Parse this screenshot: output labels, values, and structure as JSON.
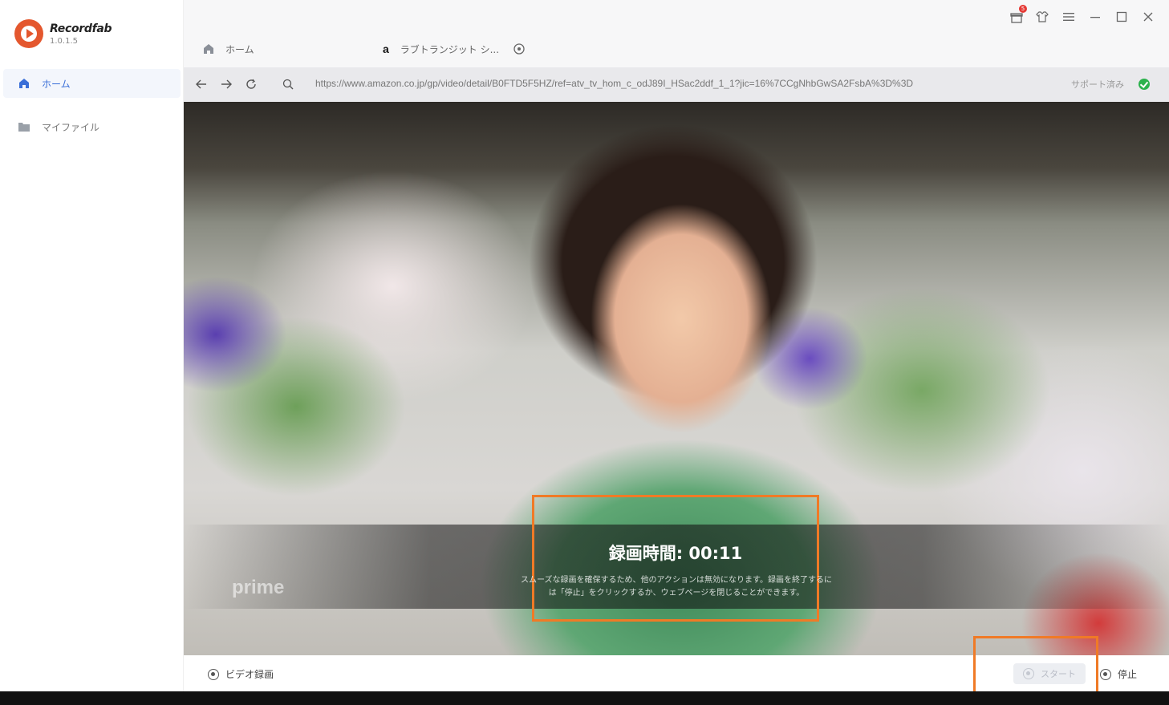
{
  "app": {
    "name": "Recordfab",
    "version": "1.0.1.5"
  },
  "sidebar": {
    "items": [
      {
        "label": "ホーム",
        "icon": "home-icon",
        "active": true
      },
      {
        "label": "マイファイル",
        "icon": "folder-icon",
        "active": false
      }
    ]
  },
  "tabs": [
    {
      "label": "ホーム",
      "icon": "home-icon"
    },
    {
      "label": "ラブトランジット シ...",
      "icon": "amazon-icon"
    }
  ],
  "window_controls": {
    "notification_badge": "5",
    "icons": [
      "gift-icon",
      "shirt-icon",
      "menu-icon",
      "minimize-icon",
      "maximize-icon",
      "close-icon"
    ]
  },
  "address": {
    "url": "https://www.amazon.co.jp/gp/video/detail/B0FTD5F5HZ/ref=atv_tv_hom_c_odJ89I_HSac2ddf_1_1?jic=16%7CCgNhbGwSA2FsbA%3D%3D",
    "support_text": "サポート済み"
  },
  "video": {
    "record_time_label": "録画時間: 00:11",
    "note_line1": "スムーズな録画を確保するため、他のアクションは無効になります。録画を終了するに",
    "note_line2": "は「停止」をクリックするか、ウェブページを閉じることができます。",
    "watermark": "prime"
  },
  "bottom": {
    "video_record_label": "ビデオ録画",
    "start_label": "スタート",
    "stop_label": "停止"
  },
  "colors": {
    "accent": "#3a6fd8",
    "highlight": "#f07a26",
    "status_ok": "#2bb24c",
    "logo": "#e4572e"
  }
}
